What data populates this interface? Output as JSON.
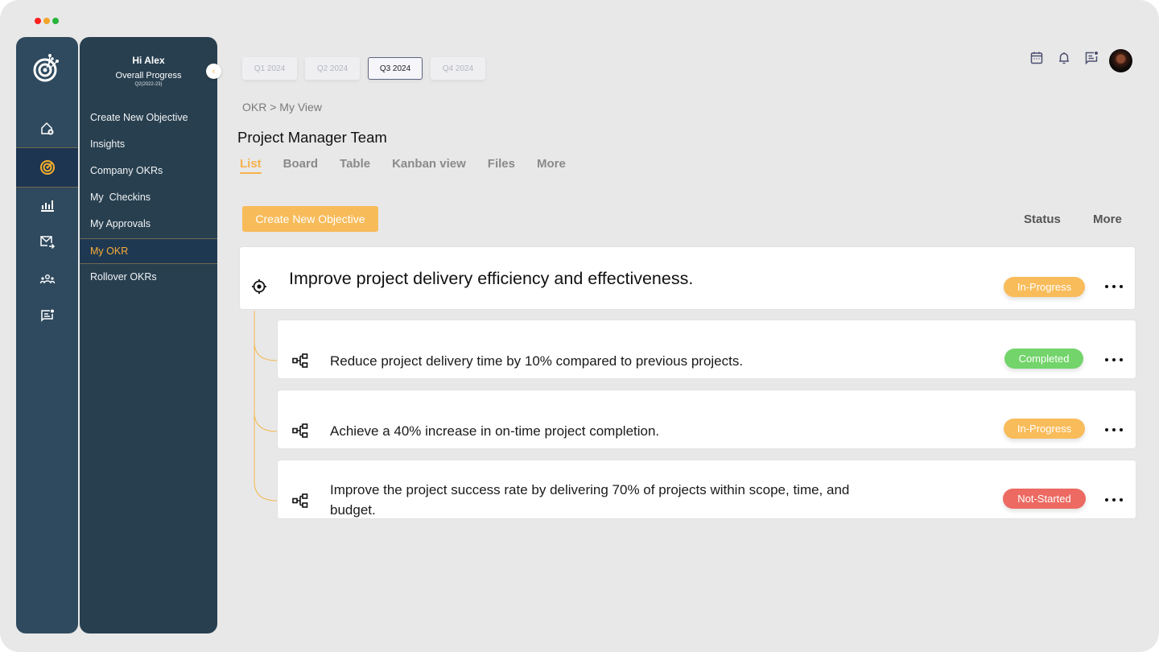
{
  "sidebar": {
    "greeting": "Hi Alex",
    "progress_label": "Overall Progress",
    "progress_period": "Q2(2022-23)",
    "rail_icons": [
      "home-add-icon",
      "target-icon",
      "bar-chart-icon",
      "mail-forward-icon",
      "team-icon",
      "chat-notification-icon"
    ],
    "items": [
      {
        "label": "Create New Objective"
      },
      {
        "label": "Insights"
      },
      {
        "label": "Company OKRs"
      },
      {
        "label": "My  Checkins"
      },
      {
        "label": "My Approvals"
      },
      {
        "label": "My OKR",
        "active": true
      },
      {
        "label": "Rollover OKRs"
      }
    ]
  },
  "quarters": [
    {
      "label": "Q1 2024"
    },
    {
      "label": "Q2 2024"
    },
    {
      "label": "Q3 2024",
      "active": true
    },
    {
      "label": "Q4 2024"
    }
  ],
  "header_icons": [
    "calendar-icon",
    "bell-icon",
    "message-icon",
    "user-avatar"
  ],
  "breadcrumb": "OKR > My View",
  "page_title": "Project Manager Team",
  "view_tabs": [
    {
      "label": "List",
      "active": true
    },
    {
      "label": "Board"
    },
    {
      "label": "Table"
    },
    {
      "label": "Kanban view"
    },
    {
      "label": "Files"
    },
    {
      "label": "More"
    }
  ],
  "actions": {
    "create_label": "Create New Objective",
    "status_label": "Status",
    "more_label": "More"
  },
  "colors": {
    "accent": "#f6b24c",
    "in_progress": "#f9bc5a",
    "completed": "#72d46a",
    "not_started": "#ec6a62",
    "sidebar_dark": "#283f4f"
  },
  "objective": {
    "title": "Improve project delivery efficiency and effectiveness.",
    "status": "In-Progress",
    "key_results": [
      {
        "title": "Reduce project delivery time by 10% compared to previous projects.",
        "status": "Completed"
      },
      {
        "title": "Achieve a 40% increase in on-time project completion.",
        "status": "In-Progress"
      },
      {
        "title": "Improve the project success rate by delivering 70% of projects within scope, time, and budget.",
        "status": "Not-Started"
      }
    ]
  }
}
